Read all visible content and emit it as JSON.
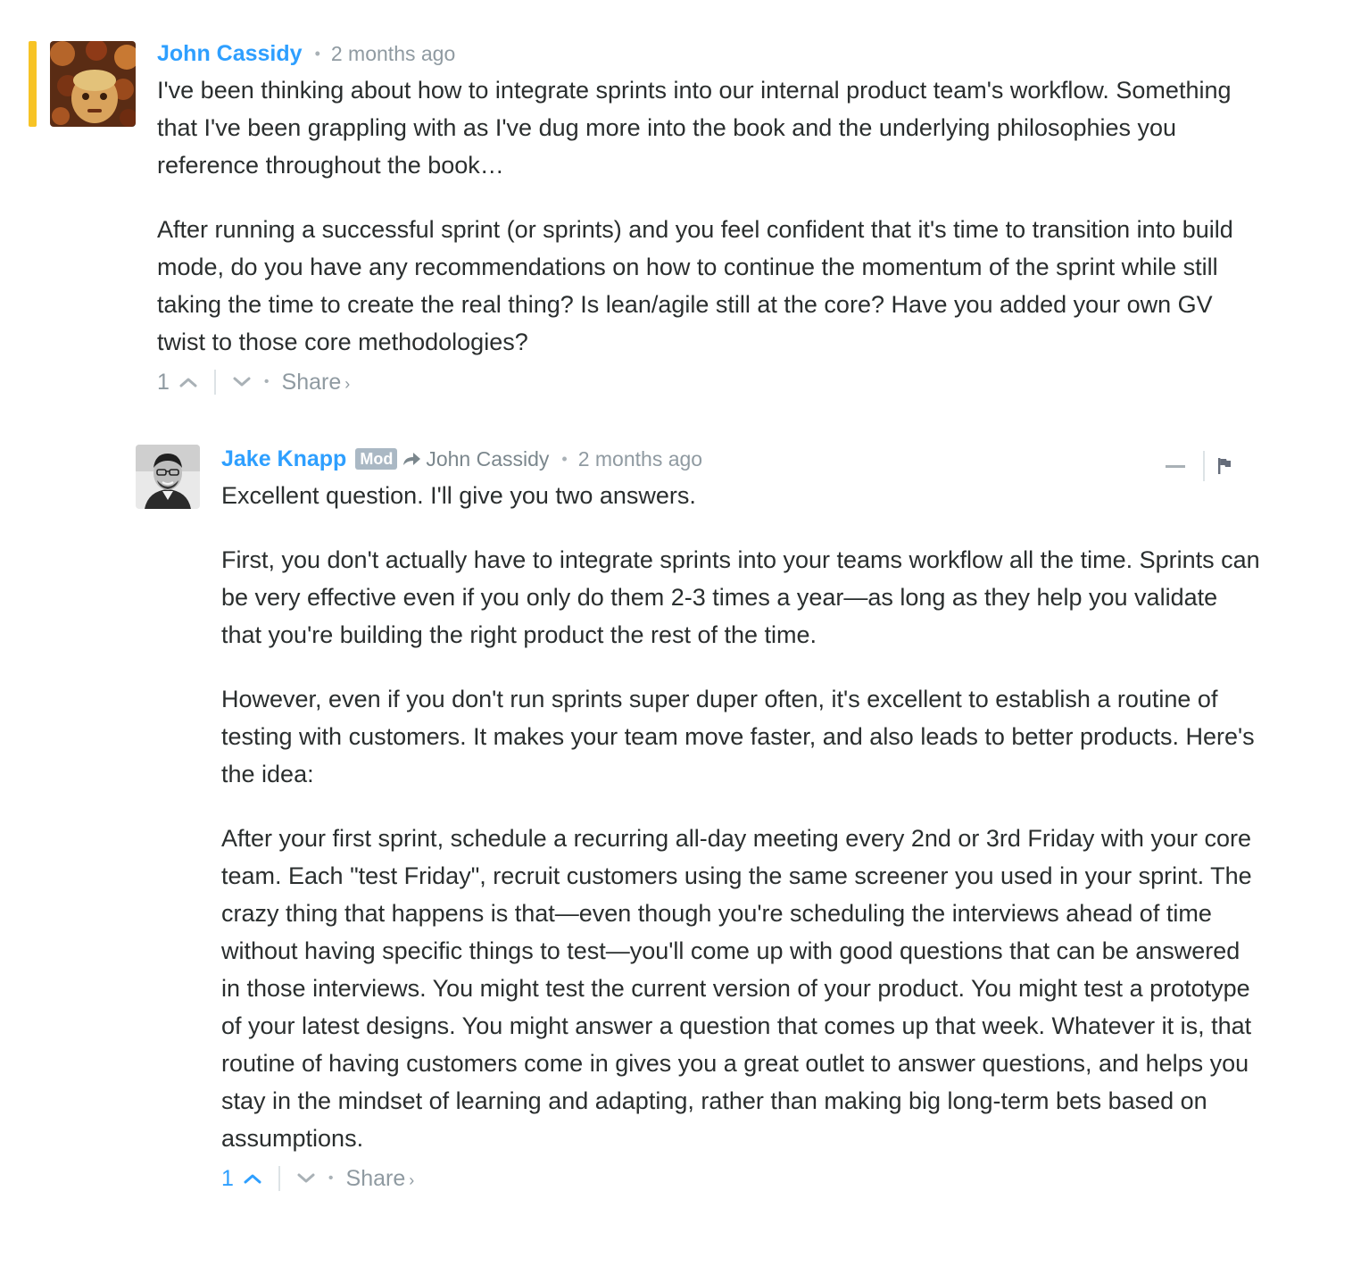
{
  "comments": [
    {
      "author": "John Cassidy",
      "time": "2 months ago",
      "paragraphs": [
        "I've been thinking about how to integrate sprints into our internal product team's workflow. Something that I've been grappling with as I've dug more into the book and the underlying philosophies you reference throughout the book…",
        "After running a successful sprint (or sprints) and you feel confident that it's time to transition into build mode, do you have any recommendations on how to continue the momentum of the sprint while still taking the time to create the real thing? Is lean/agile still at the core? Have you added your own GV twist to those core methodologies?"
      ],
      "votes": "1",
      "share_label": "Share",
      "share_arrow": "›"
    },
    {
      "author": "Jake Knapp",
      "badge": "Mod",
      "reply_to": "John Cassidy",
      "time": "2 months ago",
      "paragraphs": [
        "Excellent question. I'll give you two answers.",
        "First, you don't actually have to integrate sprints into your teams workflow all the time. Sprints can be very effective even if you only do them 2-3 times a year—as long as they help you validate that you're building the right product the rest of the time.",
        "However, even if you don't run sprints super duper often, it's excellent to establish a routine of testing with customers. It makes your team move faster, and also leads to better products. Here's the idea:",
        "After your first sprint, schedule a recurring all-day meeting every 2nd or 3rd Friday with your core team. Each \"test Friday\", recruit customers using the same screener you used in your sprint. The crazy thing that happens is that—even though you're scheduling the interviews ahead of time without having specific things to test—you'll come up with good questions that can be answered in those interviews. You might test the current version of your product. You might test a prototype of your latest designs. You might answer a question that comes up that week. Whatever it is, that routine of having customers come in gives you a great outlet to answer questions, and helps you stay in the mindset of learning and adapting, rather than making big long-term bets based on assumptions."
      ],
      "votes": "1",
      "share_label": "Share",
      "share_arrow": "›"
    }
  ],
  "colors": {
    "author_link": "#2e9fff",
    "highlight": "#f7c325",
    "muted": "#8f9aa1",
    "text": "#2a2e2e"
  },
  "icons": [
    "upvote-chevron-icon",
    "downvote-chevron-icon",
    "reply-arrow-icon",
    "collapse-icon",
    "flag-icon"
  ]
}
